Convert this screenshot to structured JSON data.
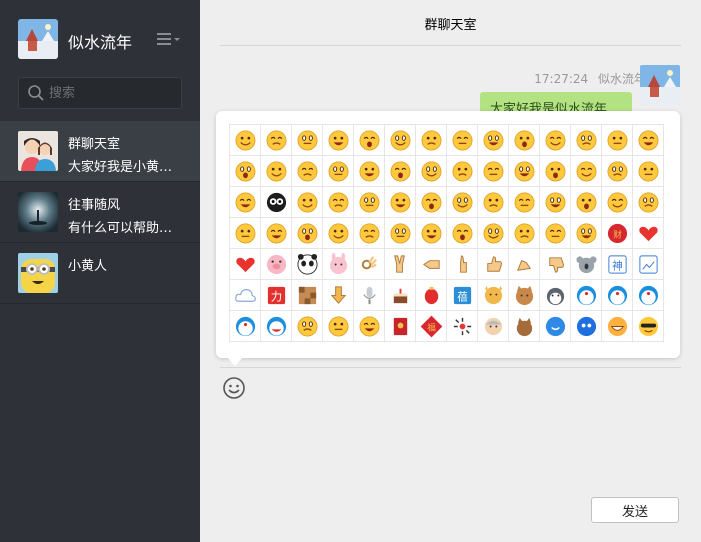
{
  "profile": {
    "name": "似水流年",
    "menu_icon": "menu-icon"
  },
  "search": {
    "placeholder": "搜索"
  },
  "chats": [
    {
      "name": "群聊天室",
      "preview": "大家好我是小黄…",
      "avatar": "couple-avatar",
      "active": true
    },
    {
      "name": "往事随风",
      "preview": "有什么可以帮助…",
      "avatar": "lamp-avatar",
      "active": false
    },
    {
      "name": "小黄人",
      "preview": "",
      "avatar": "minion-avatar",
      "active": false
    }
  ],
  "main": {
    "title": "群聊天室",
    "message": {
      "time": "17:27:24",
      "sender": "似水流年",
      "text": "大家好我是似水流年"
    },
    "send_label": "发送"
  },
  "emoji_panel": {
    "emojis": [
      "grin",
      "heart-eyes",
      "shy",
      "cry-laugh",
      "smirk",
      "wink",
      "scared",
      "cool-glasses",
      "smile",
      "big-grin",
      "laugh",
      "happy",
      "blush",
      "pout",
      "surprised",
      "giggle",
      "tongue",
      "sealed",
      "angry",
      "confused",
      "cry",
      "sweat",
      "shock",
      "nervous",
      "grimace",
      "dizzy",
      "frown",
      "yawn",
      "shush",
      "black-ghost",
      "sad",
      "sob",
      "hug",
      "hands-up",
      "rage",
      "worry",
      "smug",
      "sly",
      "side-eye",
      "cringe",
      "tear",
      "sleepy",
      "money",
      "flushed",
      "sunglasses",
      "kiss-heart",
      "sigh",
      "peek",
      "dazed",
      "sulk",
      "shocked",
      "eyeroll",
      "tired",
      "struggle",
      "fortune",
      "red-heart",
      "heart",
      "pig",
      "panda",
      "rabbit",
      "ok-hand",
      "victory",
      "thumb-left",
      "point",
      "thumbs-up",
      "clap",
      "thumbs-down",
      "koala",
      "shen-card",
      "picture-frame",
      "cloud",
      "li-card",
      "mosaic",
      "arrow-down",
      "microphone",
      "cake",
      "lantern",
      "zai-card",
      "dog",
      "cat",
      "husky",
      "doraemon",
      "doraemon-2",
      "doraemon-3",
      "doraemon-cry",
      "doraemon-laugh",
      "laughing",
      "thinking",
      "shrug",
      "red-envelope",
      "fortune-envelope",
      "fireworks",
      "grandpa",
      "kitten",
      "bird",
      "blue-ghost",
      "yellow-grin",
      "cool-face"
    ]
  },
  "colors": {
    "sidebar": "#2e3238",
    "bubble": "#b2e281",
    "emoji_yellow": "#ffc83d"
  }
}
